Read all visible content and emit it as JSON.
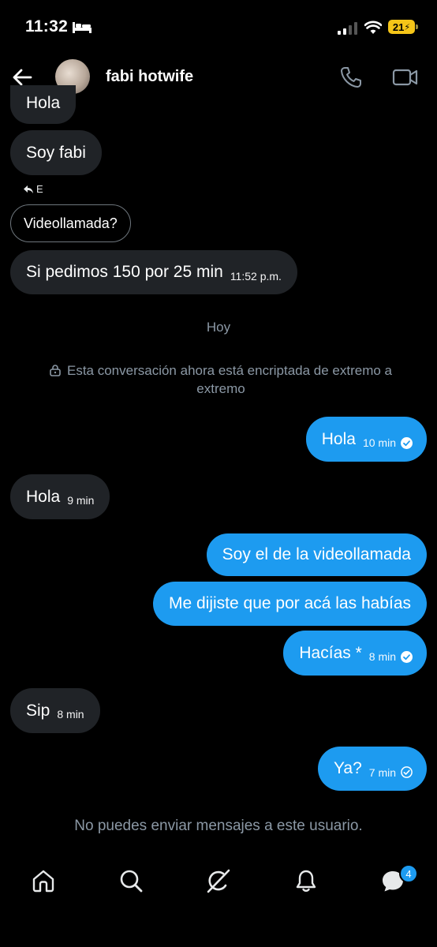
{
  "status_bar": {
    "time": "11:32",
    "battery": "21"
  },
  "header": {
    "contact_name": "fabi hotwife"
  },
  "messages": [
    {
      "dir": "in",
      "text": "Hola",
      "time": ""
    },
    {
      "dir": "in",
      "text": "Soy fabi",
      "time": ""
    },
    {
      "dir": "in",
      "text": "Si pedimos 150 por 25 min",
      "time": "11:52 p.m."
    },
    {
      "dir": "out",
      "text": "Hola",
      "time": "10 min"
    },
    {
      "dir": "in",
      "text": "Hola",
      "time": "9 min"
    },
    {
      "dir": "out",
      "text": "Soy el de la videollamada",
      "time": ""
    },
    {
      "dir": "out",
      "text": "Me dijiste que por acá las habías",
      "time": ""
    },
    {
      "dir": "out",
      "text": "Hacías *",
      "time": "8 min"
    },
    {
      "dir": "in",
      "text": "Sip",
      "time": "8 min"
    },
    {
      "dir": "out",
      "text": "Ya?",
      "time": "7 min"
    }
  ],
  "reply": {
    "label": "E",
    "quoted_text": "Videollamada?"
  },
  "day_separator": "Hoy",
  "encryption_notice": "Esta conversación ahora está encriptada de extremo a extremo",
  "cannot_send_notice": "No puedes enviar mensajes a este usuario.",
  "nav": {
    "items": [
      "home-icon",
      "search-icon",
      "grok-icon",
      "notifications-icon",
      "messages-icon"
    ],
    "messages_badge": "4"
  },
  "colors": {
    "accent": "#1d9bf0",
    "incoming_bubble": "#202327",
    "muted_text": "#8b98a5"
  }
}
